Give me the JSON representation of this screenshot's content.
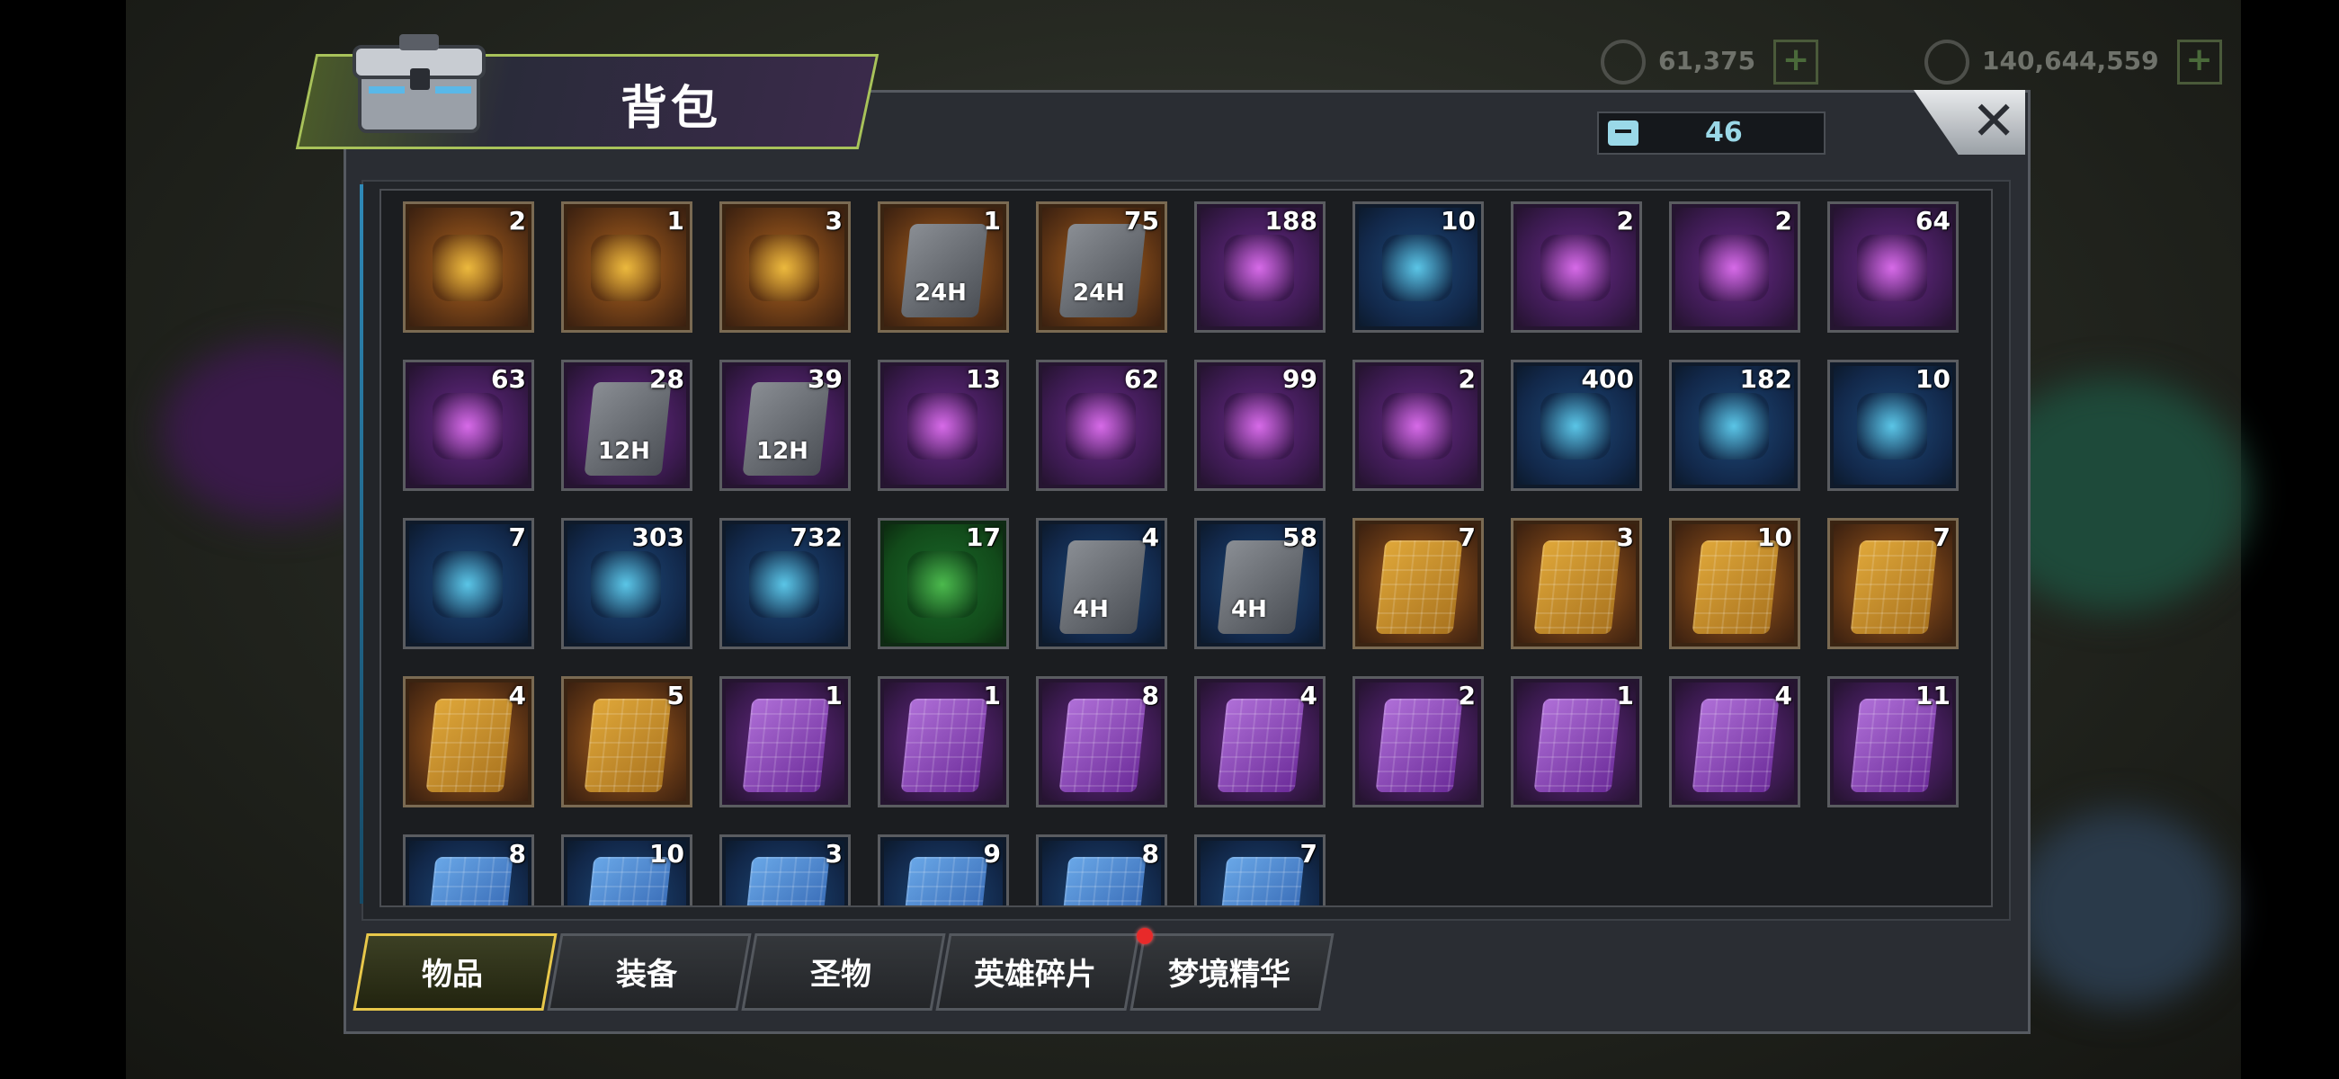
{
  "hud": {
    "gems": "61,375",
    "gold": "140,644,559"
  },
  "window": {
    "title": "背包",
    "capacity_value": "46"
  },
  "colors": {
    "active_tab_border": "#e8c84a",
    "capacity_text": "#9ad8e8",
    "notification_dot": "#e82a2a"
  },
  "items": [
    {
      "icon": "treasure-chest-icon",
      "count": "2",
      "frame": "orange"
    },
    {
      "icon": "green-leaf-token-icon",
      "count": "1",
      "frame": "orange"
    },
    {
      "icon": "silver-coin-icon",
      "count": "3",
      "frame": "orange"
    },
    {
      "icon": "gem-speedup-card-icon",
      "count": "1",
      "frame": "orange",
      "label": "24H"
    },
    {
      "icon": "gold-speedup-card-icon",
      "count": "75",
      "frame": "orange",
      "label": "24H"
    },
    {
      "icon": "lips-bottlecap-icon",
      "count": "188",
      "frame": "purple"
    },
    {
      "icon": "clover-coin-icon",
      "count": "10",
      "frame": "blue"
    },
    {
      "icon": "meat-leg-icon",
      "count": "2",
      "frame": "purple"
    },
    {
      "icon": "robot-toy-icon",
      "count": "2",
      "frame": "purple"
    },
    {
      "icon": "film-reel-icon",
      "count": "64",
      "frame": "purple"
    },
    {
      "icon": "rocket-boost-icon",
      "count": "63",
      "frame": "purple"
    },
    {
      "icon": "gem-speedup-card-icon",
      "count": "28",
      "frame": "purple",
      "label": "12H"
    },
    {
      "icon": "gold-speedup-card-icon",
      "count": "39",
      "frame": "purple",
      "label": "12H"
    },
    {
      "icon": "purple-bottlecap-icon",
      "count": "13",
      "frame": "purple"
    },
    {
      "icon": "casino-chip-icon",
      "count": "62",
      "frame": "purple"
    },
    {
      "icon": "police-badge-icon",
      "count": "99",
      "frame": "purple"
    },
    {
      "icon": "syringe-icon",
      "count": "2",
      "frame": "purple"
    },
    {
      "icon": "gold-pyramid-icon",
      "count": "400",
      "frame": "blue"
    },
    {
      "icon": "cinema-ticket-icon",
      "count": "182",
      "frame": "blue"
    },
    {
      "icon": "stopwatch-coin-icon",
      "count": "10",
      "frame": "blue"
    },
    {
      "icon": "b-bottlecap-icon",
      "count": "7",
      "frame": "blue"
    },
    {
      "icon": "red-casino-chip-icon",
      "count": "303",
      "frame": "blue"
    },
    {
      "icon": "bullet-icon",
      "count": "732",
      "frame": "blue"
    },
    {
      "icon": "green-cap-icon",
      "count": "17",
      "frame": "green"
    },
    {
      "icon": "gem-speedup-card-icon",
      "count": "4",
      "frame": "blue",
      "label": "4H"
    },
    {
      "icon": "gold-speedup-card-icon",
      "count": "58",
      "frame": "blue",
      "label": "4H"
    },
    {
      "icon": "gold-blueprint-glasses-icon",
      "count": "7",
      "frame": "orange",
      "card": "gold"
    },
    {
      "icon": "gold-blueprint-revolver-icon",
      "count": "3",
      "frame": "orange",
      "card": "gold"
    },
    {
      "icon": "gold-blueprint-boots-icon",
      "count": "10",
      "frame": "orange",
      "card": "gold"
    },
    {
      "icon": "gold-blueprint-shirt-icon",
      "count": "7",
      "frame": "orange",
      "card": "gold"
    },
    {
      "icon": "gold-blueprint-swords-icon",
      "count": "4",
      "frame": "orange",
      "card": "gold"
    },
    {
      "icon": "gold-blueprint-hat-icon",
      "count": "5",
      "frame": "orange",
      "card": "gold"
    },
    {
      "icon": "purple-blueprint-boots-icon",
      "count": "1",
      "frame": "purple",
      "card": "violet"
    },
    {
      "icon": "purple-blueprint-revolver-icon",
      "count": "1",
      "frame": "purple",
      "card": "violet"
    },
    {
      "icon": "purple-blueprint-glasses-icon",
      "count": "8",
      "frame": "purple",
      "card": "violet"
    },
    {
      "icon": "purple-blueprint-swords-icon",
      "count": "4",
      "frame": "purple",
      "card": "violet"
    },
    {
      "icon": "purple-blueprint-hat-icon",
      "count": "2",
      "frame": "purple",
      "card": "violet"
    },
    {
      "icon": "purple-blueprint-boots-icon",
      "count": "1",
      "frame": "purple",
      "card": "violet"
    },
    {
      "icon": "purple-blueprint-revolver-icon",
      "count": "4",
      "frame": "purple",
      "card": "violet"
    },
    {
      "icon": "purple-blueprint-shirt-icon",
      "count": "11",
      "frame": "purple",
      "card": "violet"
    },
    {
      "icon": "blue-blueprint-glasses-icon",
      "count": "8",
      "frame": "blue",
      "card": "sky"
    },
    {
      "icon": "blue-blueprint-swords-icon",
      "count": "10",
      "frame": "blue",
      "card": "sky"
    },
    {
      "icon": "blue-blueprint-revolver-icon",
      "count": "3",
      "frame": "blue",
      "card": "sky"
    },
    {
      "icon": "blue-blueprint-hat-icon",
      "count": "9",
      "frame": "blue",
      "card": "sky"
    },
    {
      "icon": "blue-blueprint-shirt-icon",
      "count": "8",
      "frame": "blue",
      "card": "sky"
    },
    {
      "icon": "blue-blueprint-boots-icon",
      "count": "7",
      "frame": "blue",
      "card": "sky"
    }
  ],
  "tabs": [
    {
      "label": "物品",
      "active": true
    },
    {
      "label": "装备",
      "active": false
    },
    {
      "label": "圣物",
      "active": false
    },
    {
      "label": "英雄碎片",
      "active": false,
      "notification": true
    },
    {
      "label": "梦境精华",
      "active": false
    }
  ]
}
